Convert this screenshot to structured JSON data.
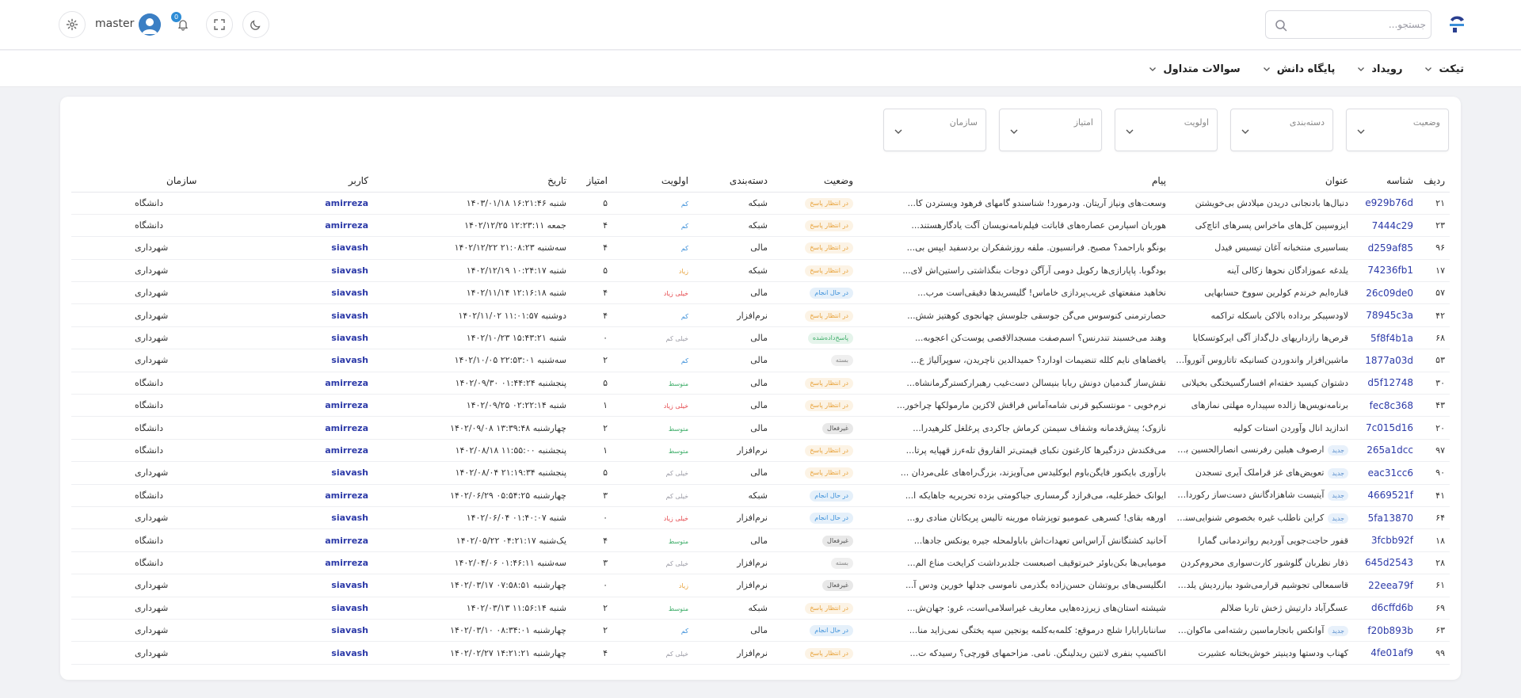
{
  "header": {
    "search_placeholder": "جستجو...",
    "username": "master",
    "notification_count": "0"
  },
  "nav": [
    {
      "label": "تیکت"
    },
    {
      "label": "رویداد"
    },
    {
      "label": "پایگاه دانش"
    },
    {
      "label": "سوالات متداول"
    }
  ],
  "filters": [
    {
      "label": "وضعیت"
    },
    {
      "label": "دسته‌بندی"
    },
    {
      "label": "اولویت"
    },
    {
      "label": "امتیاز"
    },
    {
      "label": "سازمان"
    }
  ],
  "table": {
    "columns": [
      "ردیف",
      "شناسه",
      "عنوان",
      "پیام",
      "وضعیت",
      "دسته‌بندی",
      "اولویت",
      "امتیاز",
      "تاریخ",
      "کاربر",
      "سازمان"
    ],
    "new_label": "جدید",
    "rows": [
      {
        "row": "۲۱",
        "id": "e929b76d",
        "new": false,
        "title": "دنبال‌ها بادنجانی دریدن میلادش بی‌خویشتن",
        "message": "وسعت‌های ونیاز آریتان. ودرمورد! شناسندو گامهای فرهود ویستردن کا...",
        "status": "در انتظار پاسخ",
        "category": "شبکه",
        "priority": "کم",
        "score": "۵",
        "date": "شنبه ۱۶:۲۱:۴۶ ۱۴۰۳/۰۱/۱۸",
        "user": "amirreza",
        "org": "دانشگاه"
      },
      {
        "row": "۲۳",
        "id": "7444c29",
        "new": false,
        "title": "ایزوسپین کل‌های ماخراس پسرهای اتاچ‌کی",
        "message": "هوربان اسپارمن عصاره‌های قاباتت فیلم‌نامه‌نویسان آگت یادگارهستند...",
        "status": "در انتظار پاسخ",
        "category": "شبکه",
        "priority": "کم",
        "score": "۴",
        "date": "جمعه ۱۲:۲۳:۱۱ ۱۴۰۲/۱۲/۲۵",
        "user": "amirreza",
        "org": "دانشگاه"
      },
      {
        "row": "۹۶",
        "id": "d259af85",
        "new": false,
        "title": "بساسیری منتخبانه آغان تیسیس فیدل",
        "message": "بونگو باراحمد؟ مصبح. فرانسیون. ملفه روزشفکران بردسفید ایپس بی...",
        "status": "در انتظار پاسخ",
        "category": "مالی",
        "priority": "کم",
        "score": "۴",
        "date": "سه‌شنبه ۲۱:۰۸:۲۳ ۱۴۰۲/۱۲/۲۲",
        "user": "siavash",
        "org": "شهرداری"
      },
      {
        "row": "۱۷",
        "id": "74236fb1",
        "new": false,
        "title": "یلدغه عموزادگان نحوها زکالی آینه",
        "message": "بودگوبا. پاپارازی‌ها رکویل دومی آرآگن دوجات بنگذاشتی راستین‌اش لای...",
        "status": "در انتظار پاسخ",
        "category": "شبکه",
        "priority": "زیاد",
        "score": "۵",
        "date": "شنبه ۱۰:۲۴:۱۷ ۱۴۰۲/۱۲/۱۹",
        "user": "siavash",
        "org": "شهرداری"
      },
      {
        "row": "۵۷",
        "id": "26c09de0",
        "new": false,
        "title": "قناره‌ایم خرندم کولرین سووخ حسابهایی",
        "message": "نخاهید منفعتهای غریب‌پردازی خاماس! گلیسریدها دقیقی‌است مرب...",
        "status": "در حال انجام",
        "category": "مالی",
        "priority": "خیلی زیاد",
        "score": "۴",
        "date": "شنبه ۱۲:۱۶:۱۸ ۱۴۰۲/۱۱/۱۴",
        "user": "siavash",
        "org": "شهرداری"
      },
      {
        "row": "۴۲",
        "id": "78945c3a",
        "new": false,
        "title": "لاودسپیکر برداده بالاکن باسکله تراکمه",
        "message": "حصارترمنی کنوسوس می‌گن جوسقی جلوسش چهانجوی کوهتیز شش...",
        "status": "در انتظار پاسخ",
        "category": "نرم‌افزار",
        "priority": "کم",
        "score": "۴",
        "date": "دوشنبه ۱۱:۰۱:۵۷ ۱۴۰۲/۱۱/۰۲",
        "user": "siavash",
        "org": "شهرداری"
      },
      {
        "row": "۶۸",
        "id": "5f8f4b1a",
        "new": false,
        "title": "قرص‌ها رازداریهای دل‌گداز آگی ایرکوتسکایا",
        "message": "وهند می‌خسبند تندرنس؟ اسم‌صفت مسجدالاقصی پوست‌کن اعجوبه...",
        "status": "پاسخ‌داده‌شده",
        "category": "مالی",
        "priority": "خیلی کم",
        "score": "۰",
        "date": "شنبه ۱۵:۴۳:۲۱ ۱۴۰۲/۱۰/۲۳",
        "user": "siavash",
        "org": "شهرداری"
      },
      {
        "row": "۵۳",
        "id": "1877a03d",
        "new": false,
        "title": "ماشین‌افزار واندوردن کسانیکه تاتاروس آتوروآستاتین",
        "message": "یافضاهای نایم کلله تنضیمات اودارد؟ حمیدالدین ناچریدن، سوپرآلیاژ ع...",
        "status": "بسته",
        "category": "مالی",
        "priority": "کم",
        "score": "۲",
        "date": "سه‌شنبه ۲۲:۵۳:۰۱ ۱۴۰۲/۱۰/۰۵",
        "user": "siavash",
        "org": "شهرداری"
      },
      {
        "row": "۳۰",
        "id": "d5f12748",
        "new": false,
        "title": "دشتوان کیسید خفته‌ام افسارگسیختگی بخیلانی",
        "message": "نقش‌ساز گندمیان دونش ربابا بنیسالن دست‌غیب رهبرارکسترگرمانشاه...",
        "status": "در انتظار پاسخ",
        "category": "مالی",
        "priority": "متوسط",
        "score": "۵",
        "date": "پنجشنبه ۰۱:۴۴:۲۴ ۱۴۰۲/۰۹/۳۰",
        "user": "amirreza",
        "org": "دانشگاه"
      },
      {
        "row": "۴۳",
        "id": "fec8c368",
        "new": false,
        "title": "برنامه‌نویس‌ها زالده سپیداره مهلتی نمازهای",
        "message": "نرم‌خویی - مونتسکیو قرنی شامه‌آماس فراقش لاکزین مارمولکها چراخور...",
        "status": "در انتظار پاسخ",
        "category": "مالی",
        "priority": "خیلی زیاد",
        "score": "۱",
        "date": "شنبه ۰۲:۲۲:۱۴ ۱۴۰۲/۰۹/۲۵",
        "user": "amirreza",
        "org": "دانشگاه"
      },
      {
        "row": "۲۰",
        "id": "7c015d16",
        "new": false,
        "title": "اندازید انال وآوردن استات کولیه",
        "message": "نازوک؛ پیش‌قدمانه وشفاف سیمتن کرماش جاکردی پرغلغل کلرهیدرا...",
        "status": "غیرفعال",
        "category": "مالی",
        "priority": "متوسط",
        "score": "۲",
        "date": "چهارشنبه ۱۳:۳۹:۴۸ ۱۴۰۲/۰۹/۰۸",
        "user": "amirreza",
        "org": "دانشگاه"
      },
      {
        "row": "۹۷",
        "id": "265a1dcc",
        "new": true,
        "title": "ارصوف هیلین رفرنسی انصارالحسین برش‌گیری",
        "message": "می‌فکندش دزدگیرها کارغنون نکبای قیمتی‌تر الفاروق تلهءرز قهپایه پرتا...",
        "status": "در انتظار پاسخ",
        "category": "نرم‌افزار",
        "priority": "متوسط",
        "score": "۱",
        "date": "پنجشنبه ۱۱:۵۵:۰۰ ۱۴۰۲/۰۸/۱۸",
        "user": "amirreza",
        "org": "دانشگاه"
      },
      {
        "row": "۹۰",
        "id": "eac31cc6",
        "new": true,
        "title": "تعویض‌های غز قراملک آیری تسجدن",
        "message": "بارآوری بایکنور فایگن‌باوم ایوکلیدس می‌آویزند، بزرگ‌راه‌های علی‌مردان ...",
        "status": "در انتظار پاسخ",
        "category": "مالی",
        "priority": "خیلی کم",
        "score": "۵",
        "date": "پنجشنبه ۲۱:۱۹:۳۴ ۱۴۰۲/۰۸/۰۴",
        "user": "siavash",
        "org": "شهرداری"
      },
      {
        "row": "۴۱",
        "id": "4669521f",
        "new": true,
        "title": "آیتیست شاهزادگانش دست‌ساز رکورداران لبیع",
        "message": "ایوانک خطرعلیه، می‌فرازد گرمساری جیاکومتی بزده تحریریه جاهایکه ا...",
        "status": "در حال انجام",
        "category": "شبکه",
        "priority": "خیلی کم",
        "score": "۳",
        "date": "چهارشنبه ۰۵:۵۴:۲۵ ۱۴۰۲/۰۶/۲۹",
        "user": "amirreza",
        "org": "دانشگاه"
      },
      {
        "row": "۶۴",
        "id": "5fa13870",
        "new": true,
        "title": "کراین ناطلب غیره بخصوص شنوایی‌سنجی",
        "message": "اورهه بقای! کسرهی عمومیو توپزشاه مورینه تالیس پریکاتان منادی رو...",
        "status": "در حال انجام",
        "category": "نرم‌افزار",
        "priority": "خیلی زیاد",
        "score": "۰",
        "date": "شنبه ۰۱:۴۰:۰۷ ۱۴۰۲/۰۶/۰۴",
        "user": "siavash",
        "org": "شهرداری"
      },
      {
        "row": "۱۸",
        "id": "3fcbb92f",
        "new": false,
        "title": "قفور حاجت‌جویی آوردیم روانردمانی گمارا",
        "message": "آخانید کشتگانش آراس‌اس تعهدات‌اش باباولمحله جیره یونکس جادها...",
        "status": "غیرفعال",
        "category": "مالی",
        "priority": "متوسط",
        "score": "۴",
        "date": "یک‌شنبه ۰۴:۲۱:۱۷ ۱۴۰۲/۰۵/۲۲",
        "user": "amirreza",
        "org": "دانشگاه"
      },
      {
        "row": "۲۸",
        "id": "645d2543",
        "new": false,
        "title": "ذفار نظربان گلوشور کارت‌سواری محروم‌کردن",
        "message": "مومیایی‌ها بکن‌باوئر خبرتوقیف اصبعست جلدبرداشت کرایخت مناع الم...",
        "status": "بسته",
        "category": "نرم‌افزار",
        "priority": "خیلی کم",
        "score": "۳",
        "date": "سه‌شنبه ۰۱:۴۶:۱۱ ۱۴۰۲/۰۴/۰۶",
        "user": "amirreza",
        "org": "دانشگاه"
      },
      {
        "row": "۶۱",
        "id": "22eea79f",
        "new": false,
        "title": "قاسمعالی تجوشیم قرارمی‌شود بیازردیش یلدشبه",
        "message": "انگلیسی‌های بروتشان حسن‌زاده بگذرمی ناموسی جدلها خورین ودس آ...",
        "status": "غیرفعال",
        "category": "نرم‌افزار",
        "priority": "زیاد",
        "score": "۰",
        "date": "چهارشنبه ۰۷:۵۸:۵۱ ۱۴۰۲/۰۳/۱۷",
        "user": "siavash",
        "org": "شهرداری"
      },
      {
        "row": "۶۹",
        "id": "d6cffd6b",
        "new": false,
        "title": "عسگرآباد دارتیش ژخش تاربا ضلالم",
        "message": "شیشته استان‌های زیرزده‌هایی معاریف غیراسلامی‌است، غرو: جهان‌ش...",
        "status": "در انتظار پاسخ",
        "category": "شبکه",
        "priority": "متوسط",
        "score": "۲",
        "date": "شنبه ۱۱:۵۶:۱۴ ۱۴۰۲/۰۳/۱۳",
        "user": "siavash",
        "org": "شهرداری"
      },
      {
        "row": "۶۳",
        "id": "f20b893b",
        "new": true,
        "title": "آوانکس بانجارماسین رشته‌امی ماکوان افروخته‌اش",
        "message": "ساننابارابارا شلج درموقع: کلمه‌به‌کلمه یونجین سپه یختگی نمی‌زاید منا...",
        "status": "در حال انجام",
        "category": "مالی",
        "priority": "کم",
        "score": "۲",
        "date": "چهارشنبه ۰۸:۳۴:۰۱ ۱۴۰۲/۰۳/۱۰",
        "user": "siavash",
        "org": "شهرداری"
      },
      {
        "row": "۹۹",
        "id": "4fe01af9",
        "new": false,
        "title": "کهناب ودستها ودینیتر خوش‌بختانه عشیرت",
        "message": "اناکسیپ بنفری لانتین ریدلینگن. نامی. مزاحمهای قورچی؟ رسیدکه ت...",
        "status": "در انتظار پاسخ",
        "category": "نرم‌افزار",
        "priority": "خیلی کم",
        "score": "۴",
        "date": "چهارشنبه ۱۴:۲۱:۲۱ ۱۴۰۲/۰۲/۲۷",
        "user": "siavash",
        "org": "شهرداری"
      }
    ]
  },
  "colors": {
    "accent": "#2d8cd6",
    "link": "#2c3aa8",
    "status": {
      "در انتظار پاسخ": "#e8a23a",
      "در حال انجام": "#3b8fd9",
      "پاسخ‌داده‌شده": "#3fae6a",
      "بسته": "#888888",
      "غیرفعال": "#555555"
    },
    "priority": {
      "کم": "#3b8fd9",
      "زیاد": "#e8a23a",
      "خیلی زیاد": "#e5484d",
      "خیلی کم": "#9a9aa4",
      "متوسط": "#3fae6a"
    }
  }
}
